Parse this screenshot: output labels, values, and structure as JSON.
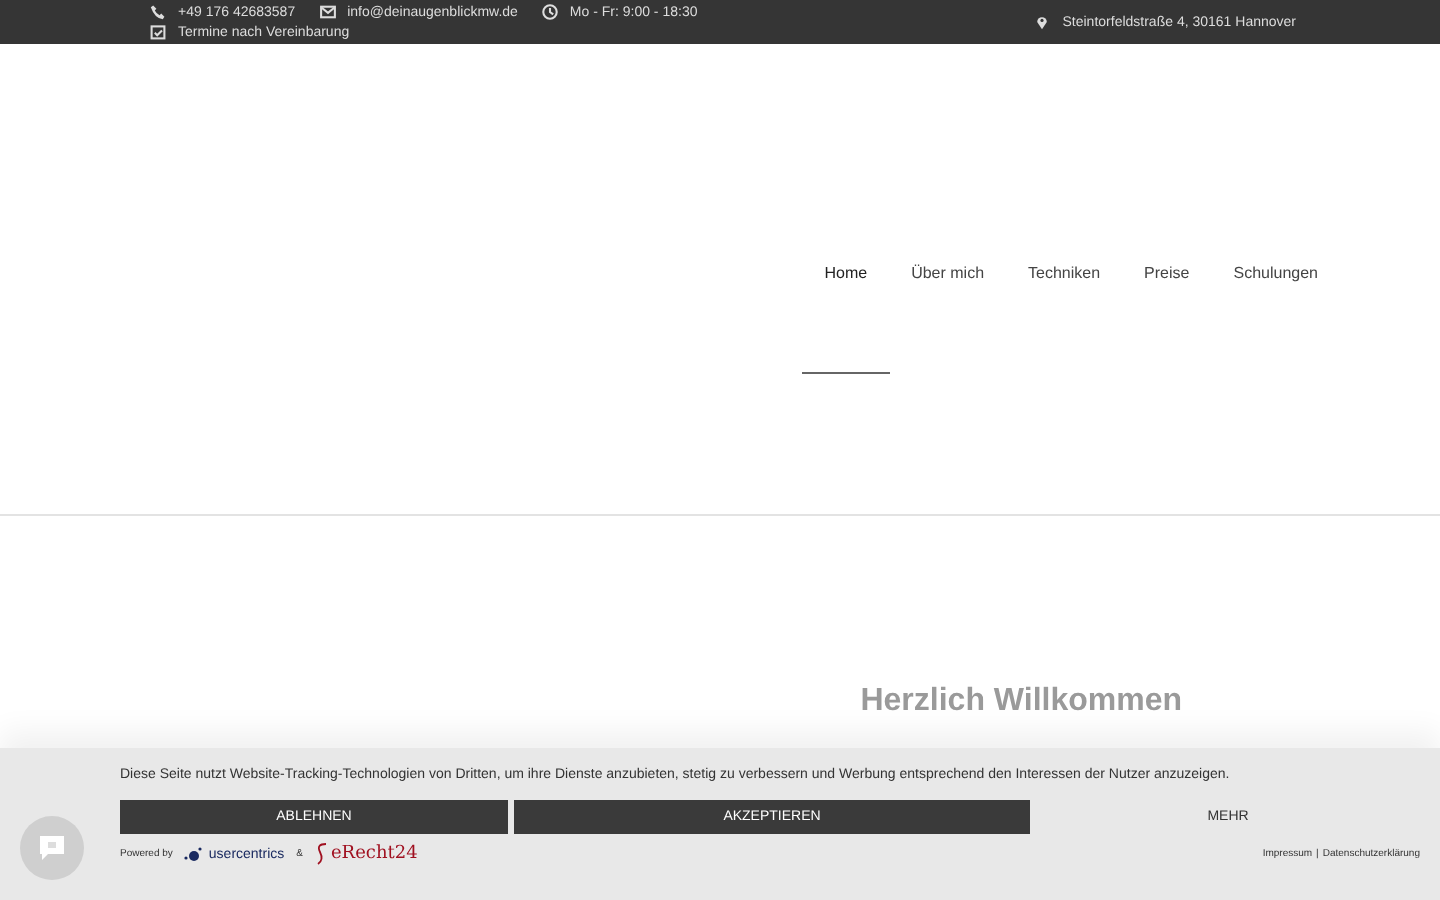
{
  "top_bar": {
    "phone": "+49 176 42683587",
    "email": "info@deinaugenblickmw.de",
    "hours": "Mo - Fr: 9:00 - 18:30",
    "appointments": "Termine nach Vereinbarung",
    "address": "Steintorfeldstraße 4, 30161 Hannover"
  },
  "nav": [
    {
      "label": "Home",
      "selected": true
    },
    {
      "label": "Über mich",
      "selected": false
    },
    {
      "label": "Techniken",
      "selected": false
    },
    {
      "label": "Preise",
      "selected": false
    },
    {
      "label": "Schulungen",
      "selected": false
    }
  ],
  "heading": "Herzlich Willkommen",
  "cookie_banner": {
    "text": "Diese Seite nutzt Website-Tracking-Technologien von Dritten, um ihre Dienste anzubieten, stetig zu verbessern und Werbung entsprechend den Interessen der Nutzer anzuzeigen.",
    "buttons": [
      {
        "label": "ABLEHNEN",
        "kind": "dark"
      },
      {
        "label": "AKZEPTIEREN",
        "kind": "dark"
      },
      {
        "label": "MEHR",
        "kind": "plain"
      }
    ],
    "powered_by": "Powered by",
    "brand_1": "usercentrics",
    "ampersand": "&",
    "brand_2": "eRecht24",
    "links": [
      "Impressum",
      "Datenschutzerklärung"
    ],
    "link_separator": "|"
  }
}
